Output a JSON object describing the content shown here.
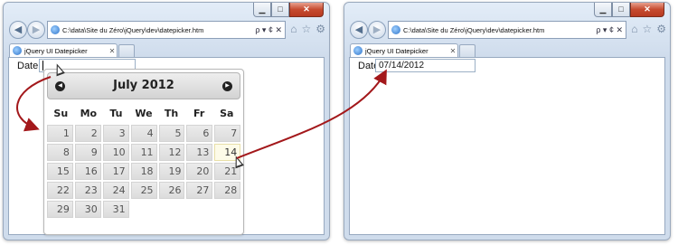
{
  "windows": [
    {
      "url": "C:\\data\\Site du Zéro\\jQuery\\dev\\datepicker.htm",
      "addr_tools": "ρ ▾ ¢ ✕",
      "tab_title": "jQuery UI Datepicker",
      "label": "Date",
      "input_value": ""
    },
    {
      "url": "C:\\data\\Site du Zéro\\jQuery\\dev\\datepicker.htm",
      "addr_tools": "ρ ▾ ¢ ✕",
      "tab_title": "jQuery UI Datepicker",
      "label": "Date",
      "input_value": "07/14/2012"
    }
  ],
  "icons": {
    "back": "back-arrow-icon",
    "forward": "forward-arrow-icon",
    "home": "home-icon",
    "favorites": "star-icon",
    "tools": "gear-icon",
    "prev_month": "triangle-left-icon",
    "next_month": "triangle-right-icon"
  },
  "datepicker": {
    "title": "July 2012",
    "weekdays": [
      "Su",
      "Mo",
      "Tu",
      "We",
      "Th",
      "Fr",
      "Sa"
    ],
    "leading_empty": 0,
    "days": [
      "1",
      "2",
      "3",
      "4",
      "5",
      "6",
      "7",
      "8",
      "9",
      "10",
      "11",
      "12",
      "13",
      "14",
      "15",
      "16",
      "17",
      "18",
      "19",
      "20",
      "21",
      "22",
      "23",
      "24",
      "25",
      "26",
      "27",
      "28",
      "29",
      "30",
      "31"
    ],
    "hovered_day": "14"
  },
  "annotation_color": "#a3181b"
}
